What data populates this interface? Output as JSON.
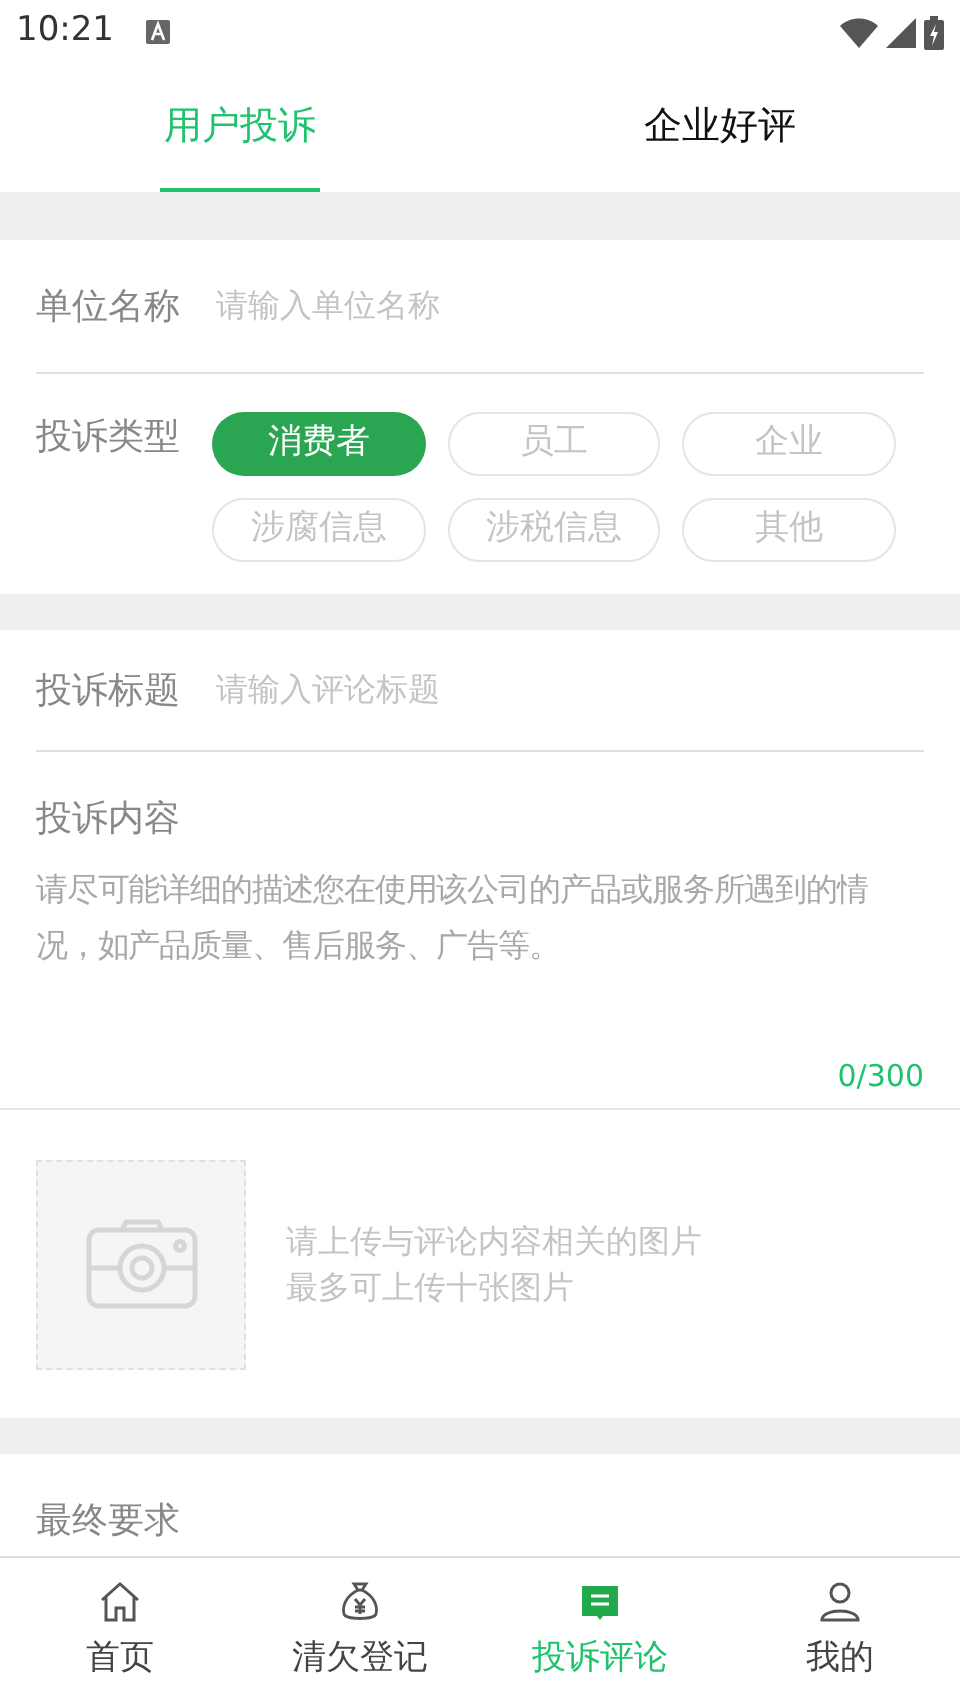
{
  "status_bar": {
    "time": "10:21"
  },
  "tabs": [
    {
      "label": "用户投诉",
      "selected": true
    },
    {
      "label": "企业好评",
      "selected": false
    }
  ],
  "unit": {
    "label": "单位名称",
    "placeholder": "请输入单位名称"
  },
  "complaint_type": {
    "label": "投诉类型",
    "options": [
      {
        "label": "消费者",
        "selected": true
      },
      {
        "label": "员工",
        "selected": false
      },
      {
        "label": "企业",
        "selected": false
      },
      {
        "label": "涉腐信息",
        "selected": false
      },
      {
        "label": "涉税信息",
        "selected": false
      },
      {
        "label": "其他",
        "selected": false
      }
    ]
  },
  "title_field": {
    "label": "投诉标题",
    "placeholder": "请输入评论标题"
  },
  "content": {
    "label": "投诉内容",
    "placeholder": "请尽可能详细的描述您在使用该公司的产品或服务所遇到的情况，如产品质量、售后服务、广告等。",
    "counter": "0/300"
  },
  "upload": {
    "hint_lines": [
      "请上传与评论内容相关的图片",
      "最多可上传十张图片"
    ]
  },
  "final_request": {
    "label": "最终要求"
  },
  "bottom_nav": [
    {
      "label": "首页",
      "kind": "home",
      "selected": false
    },
    {
      "label": "清欠登记",
      "kind": "money",
      "selected": false
    },
    {
      "label": "投诉评论",
      "kind": "comment",
      "selected": true
    },
    {
      "label": "我的",
      "kind": "user",
      "selected": false
    }
  ]
}
